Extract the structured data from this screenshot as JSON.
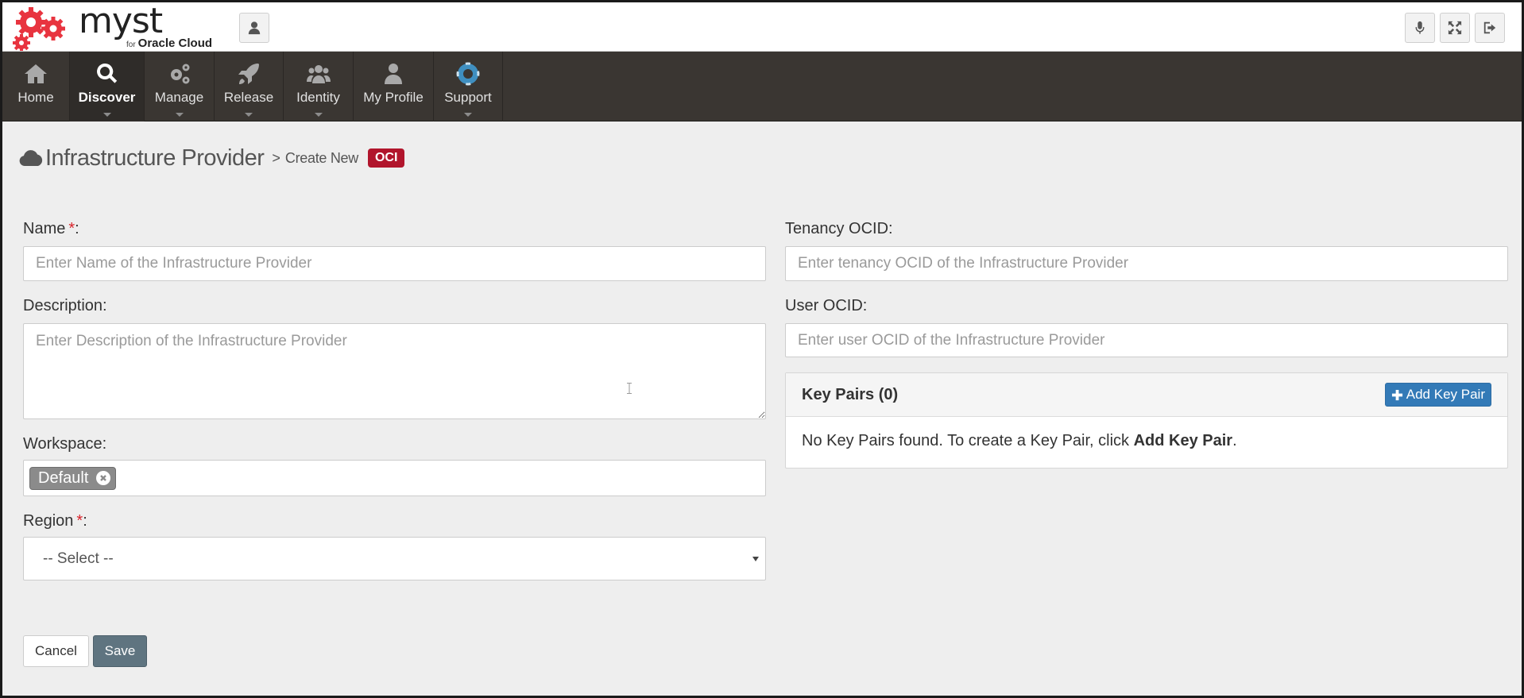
{
  "brand": {
    "name": "myst",
    "sub_for": "for",
    "sub_cloud": "Oracle Cloud"
  },
  "nav": {
    "items": [
      {
        "label": "Home",
        "icon": "home-icon",
        "active": false
      },
      {
        "label": "Discover",
        "icon": "search-icon",
        "active": true
      },
      {
        "label": "Manage",
        "icon": "gears-icon",
        "active": false
      },
      {
        "label": "Release",
        "icon": "rocket-icon",
        "active": false
      },
      {
        "label": "Identity",
        "icon": "users-icon",
        "active": false
      },
      {
        "label": "My Profile",
        "icon": "user-icon",
        "active": false
      },
      {
        "label": "Support",
        "icon": "lifebuoy-icon",
        "active": false
      }
    ]
  },
  "header_buttons": [
    "user-icon",
    "microphone-icon",
    "fullscreen-icon",
    "sign-out-icon"
  ],
  "page": {
    "title": "Infrastructure Provider",
    "separator": ">",
    "subtitle": "Create New",
    "badge": "OCI"
  },
  "form": {
    "name_label": "Name",
    "name_required": "*",
    "name_colon": ":",
    "name_placeholder": "Enter Name of the Infrastructure Provider",
    "description_label": "Description:",
    "description_placeholder": "Enter Description of the Infrastructure Provider",
    "workspace_label": "Workspace:",
    "workspace_tag": "Default",
    "region_label": "Region",
    "region_required": "*",
    "region_colon": ":",
    "region_selected": "-- Select --",
    "tenancy_label": "Tenancy OCID:",
    "tenancy_placeholder": "Enter tenancy OCID of the Infrastructure Provider",
    "user_label": "User OCID:",
    "user_placeholder": "Enter user OCID of the Infrastructure Provider"
  },
  "key_pairs": {
    "title": "Key Pairs (0)",
    "add_button": "Add Key Pair",
    "empty_prefix": "No Key Pairs found. To create a Key Pair, click ",
    "empty_bold": "Add Key Pair",
    "empty_suffix": "."
  },
  "actions": {
    "cancel": "Cancel",
    "save": "Save"
  },
  "colors": {
    "nav_bg": "#3a3632",
    "badge": "#b1152c",
    "primary": "#337ab7",
    "save": "#5f7480",
    "logo": "#e8343f"
  }
}
